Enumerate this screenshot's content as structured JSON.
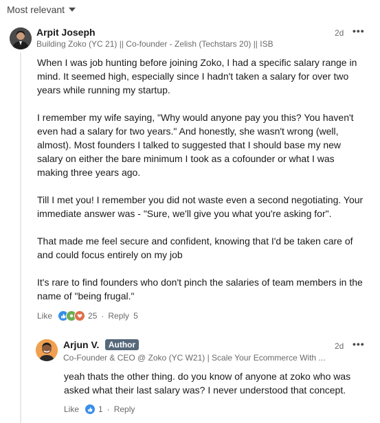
{
  "sort": {
    "label": "Most relevant"
  },
  "comment": {
    "author": "Arpit Joseph",
    "headline": "Building Zoko (YC 21) || Co-founder - Zelish (Techstars 20) || ISB",
    "time": "2d",
    "more": "•••",
    "paragraphs": [
      "When I was job hunting before joining Zoko, I had a specific salary range in mind. It seemed high, especially since I hadn't taken a salary for over two years while running my startup.",
      "I remember my wife saying, \"Why would anyone pay you this? You haven't even had a salary for two years.\" And honestly, she wasn't wrong (well, almost). Most founders I talked to suggested that I should base my new salary on either the bare minimum I took as a cofounder or what I was making three years ago.",
      "Till I met you! I remember you did not waste even a second negotiating. Your immediate answer was - \"Sure, we'll give you what you're asking for\".",
      "That made me feel secure and confident, knowing that I'd be taken care of and could focus entirely on my job",
      "It's rare to find founders who don't pinch the salaries of team members in the name of \"being frugal.\""
    ],
    "actions": {
      "like": "Like",
      "reaction_count": "25",
      "reply": "Reply",
      "reply_count": "5"
    }
  },
  "reply": {
    "author": "Arjun V.",
    "badge": "Author",
    "headline": "Co-Founder & CEO @ Zoko (YC W21) | Scale Your Ecommerce With ...",
    "time": "2d",
    "more": "•••",
    "text": "yeah thats the other thing. do you know of anyone at zoko who was asked what their last salary was? I never understood that concept.",
    "actions": {
      "like": "Like",
      "reaction_count": "1",
      "reply": "Reply"
    }
  },
  "colors": {
    "like": "#378fe9",
    "celebrate": "#6dae4f",
    "love": "#df704d",
    "author_badge": "#56687a"
  }
}
